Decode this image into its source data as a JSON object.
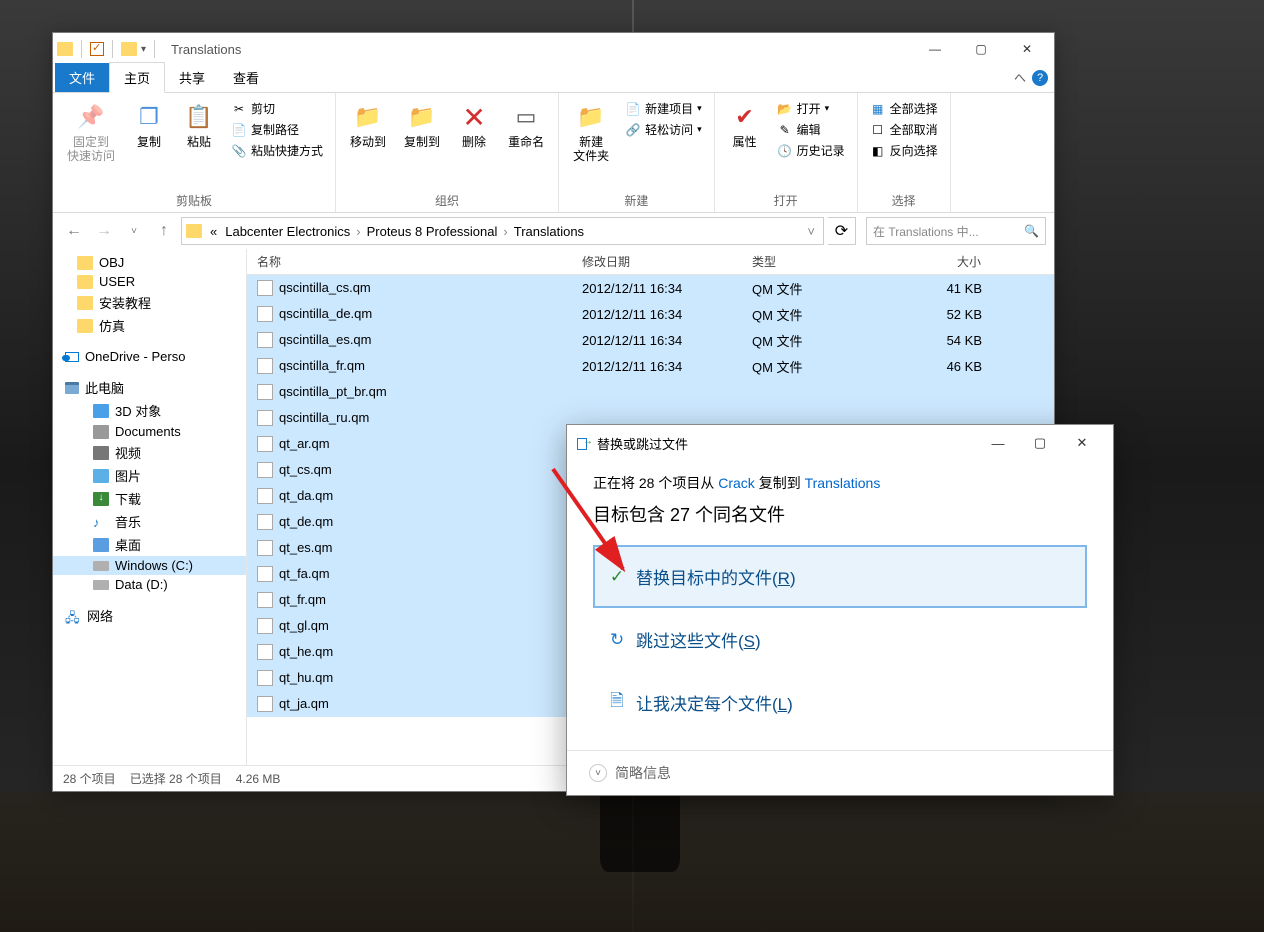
{
  "window": {
    "title": "Translations"
  },
  "tabs": {
    "file": "文件",
    "home": "主页",
    "share": "共享",
    "view": "查看"
  },
  "ribbon": {
    "pin": "固定到\n快速访问",
    "copy": "复制",
    "paste": "粘贴",
    "cut": "剪切",
    "copypath": "复制路径",
    "pasteshortcut": "粘贴快捷方式",
    "clipboard": "剪贴板",
    "moveto": "移动到",
    "copyto": "复制到",
    "delete": "删除",
    "rename": "重命名",
    "organize": "组织",
    "newfolder": "新建\n文件夹",
    "newitem": "新建项目",
    "easyaccess": "轻松访问",
    "new": "新建",
    "properties": "属性",
    "open": "打开",
    "edit": "编辑",
    "history": "历史记录",
    "opengroup": "打开",
    "selectall": "全部选择",
    "selectnone": "全部取消",
    "invertsel": "反向选择",
    "select": "选择"
  },
  "breadcrumb": {
    "prefix": "«",
    "p1": "Labcenter Electronics",
    "p2": "Proteus 8 Professional",
    "p3": "Translations"
  },
  "search": {
    "placeholder": "在 Translations 中..."
  },
  "tree": {
    "obj": "OBJ",
    "user": "USER",
    "install": "安装教程",
    "sim": "仿真",
    "onedrive": "OneDrive - Perso",
    "thispc": "此电脑",
    "threed": "3D 对象",
    "documents": "Documents",
    "video": "视频",
    "pictures": "图片",
    "downloads": "下载",
    "music": "音乐",
    "desktop": "桌面",
    "cdrive": "Windows (C:)",
    "ddrive": "Data (D:)",
    "network": "网络"
  },
  "columns": {
    "name": "名称",
    "date": "修改日期",
    "type": "类型",
    "size": "大小"
  },
  "files": [
    {
      "name": "qscintilla_cs.qm",
      "date": "2012/12/11 16:34",
      "type": "QM 文件",
      "size": "41 KB",
      "sel": true
    },
    {
      "name": "qscintilla_de.qm",
      "date": "2012/12/11 16:34",
      "type": "QM 文件",
      "size": "52 KB",
      "sel": true
    },
    {
      "name": "qscintilla_es.qm",
      "date": "2012/12/11 16:34",
      "type": "QM 文件",
      "size": "54 KB",
      "sel": true
    },
    {
      "name": "qscintilla_fr.qm",
      "date": "2012/12/11 16:34",
      "type": "QM 文件",
      "size": "46 KB",
      "sel": true
    },
    {
      "name": "qscintilla_pt_br.qm",
      "date": "",
      "type": "",
      "size": "",
      "sel": true
    },
    {
      "name": "qscintilla_ru.qm",
      "date": "",
      "type": "",
      "size": "",
      "sel": true
    },
    {
      "name": "qt_ar.qm",
      "date": "",
      "type": "",
      "size": "",
      "sel": true
    },
    {
      "name": "qt_cs.qm",
      "date": "",
      "type": "",
      "size": "",
      "sel": true
    },
    {
      "name": "qt_da.qm",
      "date": "",
      "type": "",
      "size": "",
      "sel": true
    },
    {
      "name": "qt_de.qm",
      "date": "",
      "type": "",
      "size": "",
      "sel": true
    },
    {
      "name": "qt_es.qm",
      "date": "",
      "type": "",
      "size": "",
      "sel": true
    },
    {
      "name": "qt_fa.qm",
      "date": "",
      "type": "",
      "size": "",
      "sel": true
    },
    {
      "name": "qt_fr.qm",
      "date": "",
      "type": "",
      "size": "",
      "sel": true
    },
    {
      "name": "qt_gl.qm",
      "date": "",
      "type": "",
      "size": "",
      "sel": true
    },
    {
      "name": "qt_he.qm",
      "date": "",
      "type": "",
      "size": "",
      "sel": true
    },
    {
      "name": "qt_hu.qm",
      "date": "",
      "type": "",
      "size": "",
      "sel": true
    },
    {
      "name": "qt_ja.qm",
      "date": "",
      "type": "",
      "size": "",
      "sel": true
    }
  ],
  "status": {
    "count": "28 个项目",
    "selected": "已选择 28 个项目",
    "size": "4.26 MB"
  },
  "dialog": {
    "title": "替换或跳过文件",
    "info_pre": "正在将 28 个项目从 ",
    "info_src": "Crack",
    "info_mid": " 复制到 ",
    "info_dst": "Translations",
    "head": "目标包含 27 个同名文件",
    "replace_pre": "替换目标中的文件(",
    "replace_key": "R",
    "replace_post": ")",
    "skip_pre": "跳过这些文件(",
    "skip_key": "S",
    "skip_post": ")",
    "decide_pre": "让我决定每个文件(",
    "decide_key": "L",
    "decide_post": ")",
    "less": "简略信息"
  }
}
